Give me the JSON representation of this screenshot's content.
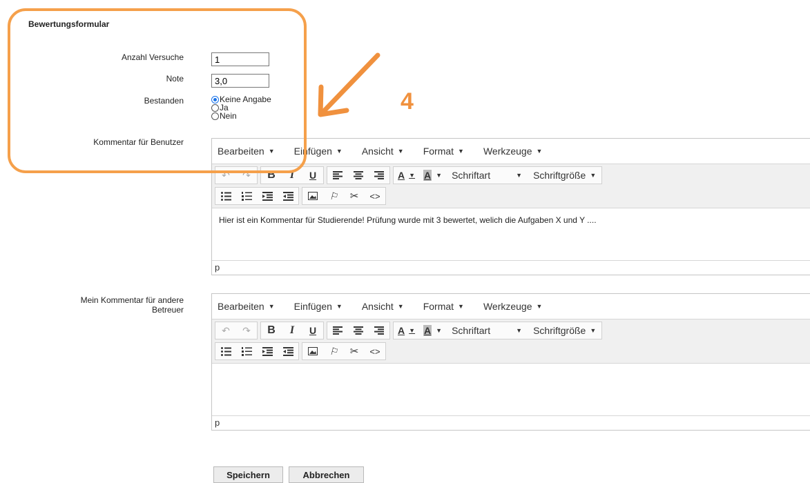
{
  "form": {
    "title": "Bewertungsformular",
    "attempts_label": "Anzahl Versuche",
    "attempts_value": "1",
    "grade_label": "Note",
    "grade_value": "3,0",
    "passed_label": "Bestanden",
    "passed_options": [
      "Keine Angabe",
      "Ja",
      "Nein"
    ],
    "passed_selected": "Keine Angabe",
    "comment_user_label": "Kommentar für Benutzer",
    "comment_tutor_label_line1": "Mein Kommentar für andere",
    "comment_tutor_label_line2": "Betreuer"
  },
  "editor": {
    "menus": [
      "Bearbeiten",
      "Einfügen",
      "Ansicht",
      "Format",
      "Werkzeuge"
    ],
    "font_family_label": "Schriftart",
    "font_size_label": "Schriftgröße",
    "bold": "B",
    "italic": "I",
    "underline": "U",
    "text_color": "A",
    "bg_color": "A",
    "status_path": "p"
  },
  "editor1_content": "Hier ist ein Kommentar für Studierende! Prüfung wurde mit 3 bewertet, welich die Aufgaben X und Y ....",
  "editor2_content": "",
  "buttons": {
    "save": "Speichern",
    "cancel": "Abbrechen"
  },
  "annotation": {
    "number": "4",
    "color": "#f5a04b"
  }
}
